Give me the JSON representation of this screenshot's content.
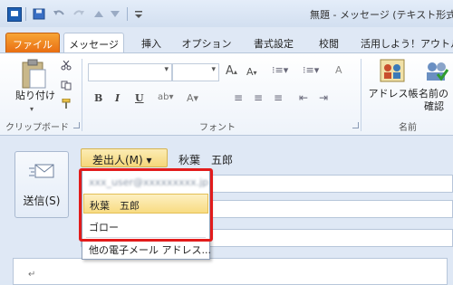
{
  "window": {
    "title": "無題 - メッセージ (テキスト形式"
  },
  "tabs": [
    "ファイル",
    "メッセージ",
    "挿入",
    "オプション",
    "書式設定",
    "校閲",
    "活用しよう！アウトル"
  ],
  "ribbon": {
    "clipboard": {
      "paste_label": "貼り付け",
      "group_label": "クリップボード"
    },
    "font": {
      "bold": "B",
      "italic": "I",
      "underline": "U",
      "group_label": "フォント"
    },
    "names": {
      "address_book_label": "アドレス帳",
      "check_names_label_line1": "名前の",
      "check_names_label_line2": "確認",
      "group_label": "名前"
    }
  },
  "compose": {
    "send_label": "送信(S)",
    "from_button_label": "差出人(M) ▾",
    "from_value": "秋葉　五郎"
  },
  "from_menu": {
    "items": [
      "xxx_user@xxxxxxxxx.jp",
      "秋葉　五郎",
      "ゴロー",
      "他の電子メール アドレス..."
    ]
  },
  "icons": [
    "app-icon",
    "save-icon",
    "undo-icon",
    "redo-icon",
    "up-icon",
    "down-icon",
    "paste-icon",
    "cut-icon",
    "copy-icon",
    "format-painter-icon",
    "address-book-icon",
    "check-names-icon",
    "send-envelope-icon"
  ],
  "colors": {
    "file_tab": "#e96e12",
    "highlight_border": "#e21b1b",
    "selected_item": "#f8dc82"
  }
}
